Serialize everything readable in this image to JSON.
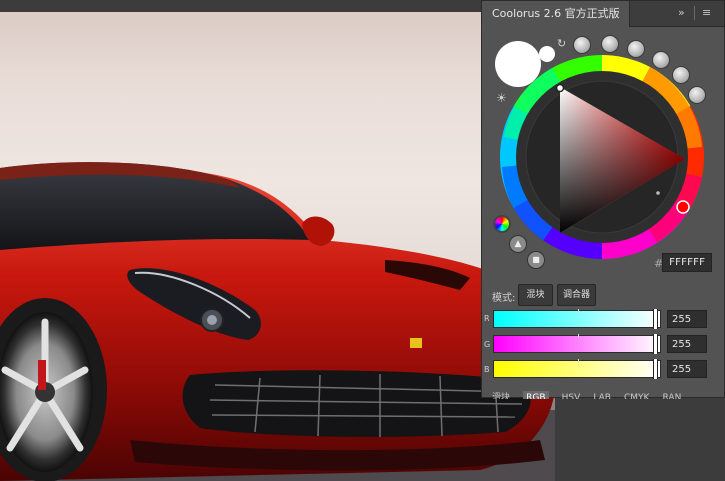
{
  "panel": {
    "title": "Coolorus 2.6 官方正式版",
    "expand_icon": "double-chevron-right-icon",
    "menu_icon": "hamburger-menu-icon"
  },
  "color": {
    "current_hex": "FFFFFF",
    "hash": "#",
    "hue_marker_color": "#ff0000"
  },
  "mode": {
    "label": "模式:",
    "buttons": [
      "混块",
      "调合器"
    ]
  },
  "sliders": [
    {
      "channel": "R",
      "value": "255",
      "gradient_start": "#00ffff",
      "gradient_end": "#ffffff"
    },
    {
      "channel": "G",
      "value": "255",
      "gradient_start": "#ff00ff",
      "gradient_end": "#ffffff"
    },
    {
      "channel": "B",
      "value": "255",
      "gradient_start": "#ffff00",
      "gradient_end": "#ffffff"
    }
  ],
  "mode_tabs": [
    "滑块",
    "RGB",
    "HSV",
    "LAB",
    "CMYK",
    "RAN"
  ],
  "active_mode_tab": "RGB"
}
